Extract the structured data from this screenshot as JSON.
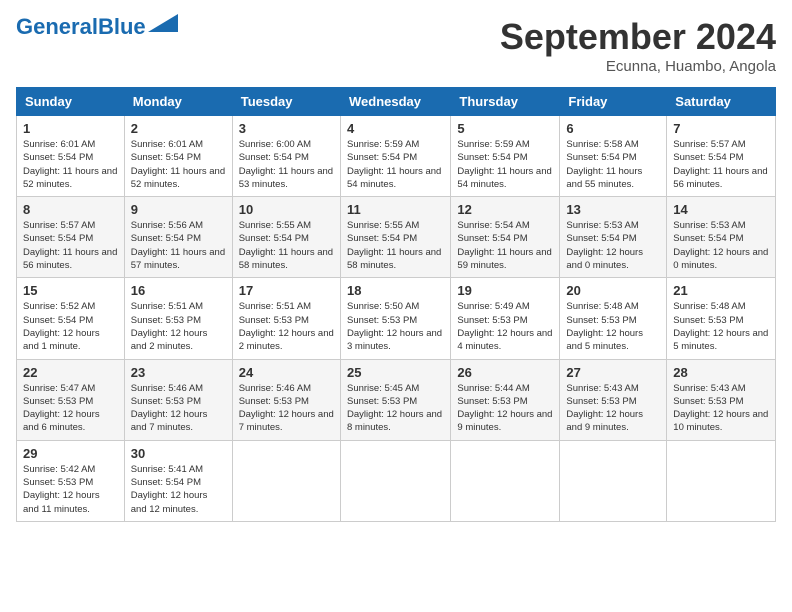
{
  "header": {
    "logo_main": "General",
    "logo_sub": "Blue",
    "month_title": "September 2024",
    "subtitle": "Ecunna, Huambo, Angola"
  },
  "columns": [
    "Sunday",
    "Monday",
    "Tuesday",
    "Wednesday",
    "Thursday",
    "Friday",
    "Saturday"
  ],
  "weeks": [
    [
      {
        "day": "1",
        "info": "Sunrise: 6:01 AM\nSunset: 5:54 PM\nDaylight: 11 hours and 52 minutes."
      },
      {
        "day": "2",
        "info": "Sunrise: 6:01 AM\nSunset: 5:54 PM\nDaylight: 11 hours and 52 minutes."
      },
      {
        "day": "3",
        "info": "Sunrise: 6:00 AM\nSunset: 5:54 PM\nDaylight: 11 hours and 53 minutes."
      },
      {
        "day": "4",
        "info": "Sunrise: 5:59 AM\nSunset: 5:54 PM\nDaylight: 11 hours and 54 minutes."
      },
      {
        "day": "5",
        "info": "Sunrise: 5:59 AM\nSunset: 5:54 PM\nDaylight: 11 hours and 54 minutes."
      },
      {
        "day": "6",
        "info": "Sunrise: 5:58 AM\nSunset: 5:54 PM\nDaylight: 11 hours and 55 minutes."
      },
      {
        "day": "7",
        "info": "Sunrise: 5:57 AM\nSunset: 5:54 PM\nDaylight: 11 hours and 56 minutes."
      }
    ],
    [
      {
        "day": "8",
        "info": "Sunrise: 5:57 AM\nSunset: 5:54 PM\nDaylight: 11 hours and 56 minutes."
      },
      {
        "day": "9",
        "info": "Sunrise: 5:56 AM\nSunset: 5:54 PM\nDaylight: 11 hours and 57 minutes."
      },
      {
        "day": "10",
        "info": "Sunrise: 5:55 AM\nSunset: 5:54 PM\nDaylight: 11 hours and 58 minutes."
      },
      {
        "day": "11",
        "info": "Sunrise: 5:55 AM\nSunset: 5:54 PM\nDaylight: 11 hours and 58 minutes."
      },
      {
        "day": "12",
        "info": "Sunrise: 5:54 AM\nSunset: 5:54 PM\nDaylight: 11 hours and 59 minutes."
      },
      {
        "day": "13",
        "info": "Sunrise: 5:53 AM\nSunset: 5:54 PM\nDaylight: 12 hours and 0 minutes."
      },
      {
        "day": "14",
        "info": "Sunrise: 5:53 AM\nSunset: 5:54 PM\nDaylight: 12 hours and 0 minutes."
      }
    ],
    [
      {
        "day": "15",
        "info": "Sunrise: 5:52 AM\nSunset: 5:54 PM\nDaylight: 12 hours and 1 minute."
      },
      {
        "day": "16",
        "info": "Sunrise: 5:51 AM\nSunset: 5:53 PM\nDaylight: 12 hours and 2 minutes."
      },
      {
        "day": "17",
        "info": "Sunrise: 5:51 AM\nSunset: 5:53 PM\nDaylight: 12 hours and 2 minutes."
      },
      {
        "day": "18",
        "info": "Sunrise: 5:50 AM\nSunset: 5:53 PM\nDaylight: 12 hours and 3 minutes."
      },
      {
        "day": "19",
        "info": "Sunrise: 5:49 AM\nSunset: 5:53 PM\nDaylight: 12 hours and 4 minutes."
      },
      {
        "day": "20",
        "info": "Sunrise: 5:48 AM\nSunset: 5:53 PM\nDaylight: 12 hours and 5 minutes."
      },
      {
        "day": "21",
        "info": "Sunrise: 5:48 AM\nSunset: 5:53 PM\nDaylight: 12 hours and 5 minutes."
      }
    ],
    [
      {
        "day": "22",
        "info": "Sunrise: 5:47 AM\nSunset: 5:53 PM\nDaylight: 12 hours and 6 minutes."
      },
      {
        "day": "23",
        "info": "Sunrise: 5:46 AM\nSunset: 5:53 PM\nDaylight: 12 hours and 7 minutes."
      },
      {
        "day": "24",
        "info": "Sunrise: 5:46 AM\nSunset: 5:53 PM\nDaylight: 12 hours and 7 minutes."
      },
      {
        "day": "25",
        "info": "Sunrise: 5:45 AM\nSunset: 5:53 PM\nDaylight: 12 hours and 8 minutes."
      },
      {
        "day": "26",
        "info": "Sunrise: 5:44 AM\nSunset: 5:53 PM\nDaylight: 12 hours and 9 minutes."
      },
      {
        "day": "27",
        "info": "Sunrise: 5:43 AM\nSunset: 5:53 PM\nDaylight: 12 hours and 9 minutes."
      },
      {
        "day": "28",
        "info": "Sunrise: 5:43 AM\nSunset: 5:53 PM\nDaylight: 12 hours and 10 minutes."
      }
    ],
    [
      {
        "day": "29",
        "info": "Sunrise: 5:42 AM\nSunset: 5:53 PM\nDaylight: 12 hours and 11 minutes."
      },
      {
        "day": "30",
        "info": "Sunrise: 5:41 AM\nSunset: 5:54 PM\nDaylight: 12 hours and 12 minutes."
      },
      {
        "day": "",
        "info": ""
      },
      {
        "day": "",
        "info": ""
      },
      {
        "day": "",
        "info": ""
      },
      {
        "day": "",
        "info": ""
      },
      {
        "day": "",
        "info": ""
      }
    ]
  ]
}
